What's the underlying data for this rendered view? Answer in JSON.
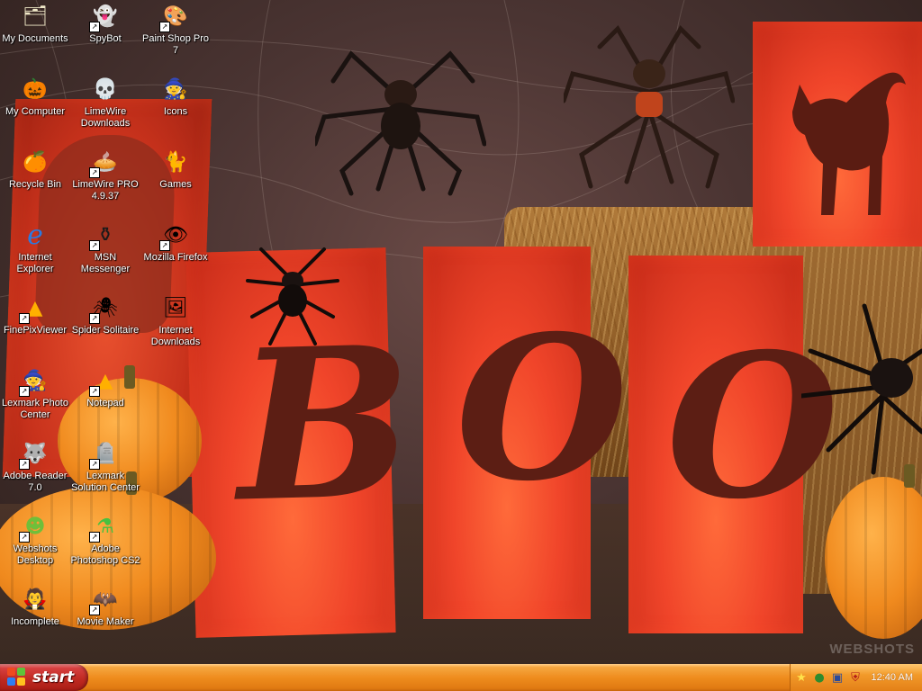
{
  "desktop": {
    "icons": [
      {
        "label": "My Documents",
        "icon": "my-documents-icon",
        "shortcut": false
      },
      {
        "label": "SpyBot",
        "icon": "spybot-ghost-icon",
        "shortcut": true
      },
      {
        "label": "Paint Shop Pro 7",
        "icon": "paint-shop-pro-icon",
        "shortcut": true
      },
      {
        "label": "My Computer",
        "icon": "pumpkin-computer-icon",
        "shortcut": false
      },
      {
        "label": "LimeWire Downloads",
        "icon": "skull-folder-icon",
        "shortcut": false
      },
      {
        "label": "Icons",
        "icon": "witch-hat-icon",
        "shortcut": false
      },
      {
        "label": "Recycle Bin",
        "icon": "recycle-bin-icon",
        "shortcut": false
      },
      {
        "label": "LimeWire PRO 4.9.37",
        "icon": "limewire-pie-icon",
        "shortcut": true
      },
      {
        "label": "Games",
        "icon": "black-cat-icon",
        "shortcut": false
      },
      {
        "label": "Internet Explorer",
        "icon": "internet-explorer-icon",
        "shortcut": false
      },
      {
        "label": "MSN Messenger",
        "icon": "cauldron-icon",
        "shortcut": true
      },
      {
        "label": "Mozilla Firefox",
        "icon": "eyeball-icon",
        "shortcut": true
      },
      {
        "label": "FinePixViewer",
        "icon": "candy-corn-icon",
        "shortcut": true
      },
      {
        "label": "Spider Solitaire",
        "icon": "spider-icon",
        "shortcut": true
      },
      {
        "label": "Internet Downloads",
        "icon": "haunted-portrait-icon",
        "shortcut": false
      },
      {
        "label": "Lexmark Photo Center",
        "icon": "witch-icon",
        "shortcut": true
      },
      {
        "label": "Notepad",
        "icon": "candy-corn-icon",
        "shortcut": true
      },
      {
        "label": "Adobe Reader 7.0",
        "icon": "werewolf-icon",
        "shortcut": true
      },
      {
        "label": "Lexmark Solution Center",
        "icon": "tombstone-icon",
        "shortcut": true
      },
      {
        "label": "Webshots Desktop",
        "icon": "frankenstein-icon",
        "shortcut": true
      },
      {
        "label": "Adobe Photoshop CS2",
        "icon": "potion-bottle-icon",
        "shortcut": true
      },
      {
        "label": "Incomplete",
        "icon": "vampire-icon",
        "shortcut": false
      },
      {
        "label": "Movie Maker",
        "icon": "bat-icon",
        "shortcut": true
      }
    ]
  },
  "wallpaper": {
    "letters": [
      "B",
      "O",
      "O"
    ],
    "watermark": "WEBSHOTS"
  },
  "taskbar": {
    "start_label": "start",
    "tray_icons": [
      "star-icon",
      "network-user-icon",
      "display-icon",
      "shield-icon"
    ],
    "clock": "12:40 AM"
  },
  "colors": {
    "taskbar": "#ef8d1e",
    "start_button": "#c02a22",
    "lantern": "#f0452a"
  }
}
